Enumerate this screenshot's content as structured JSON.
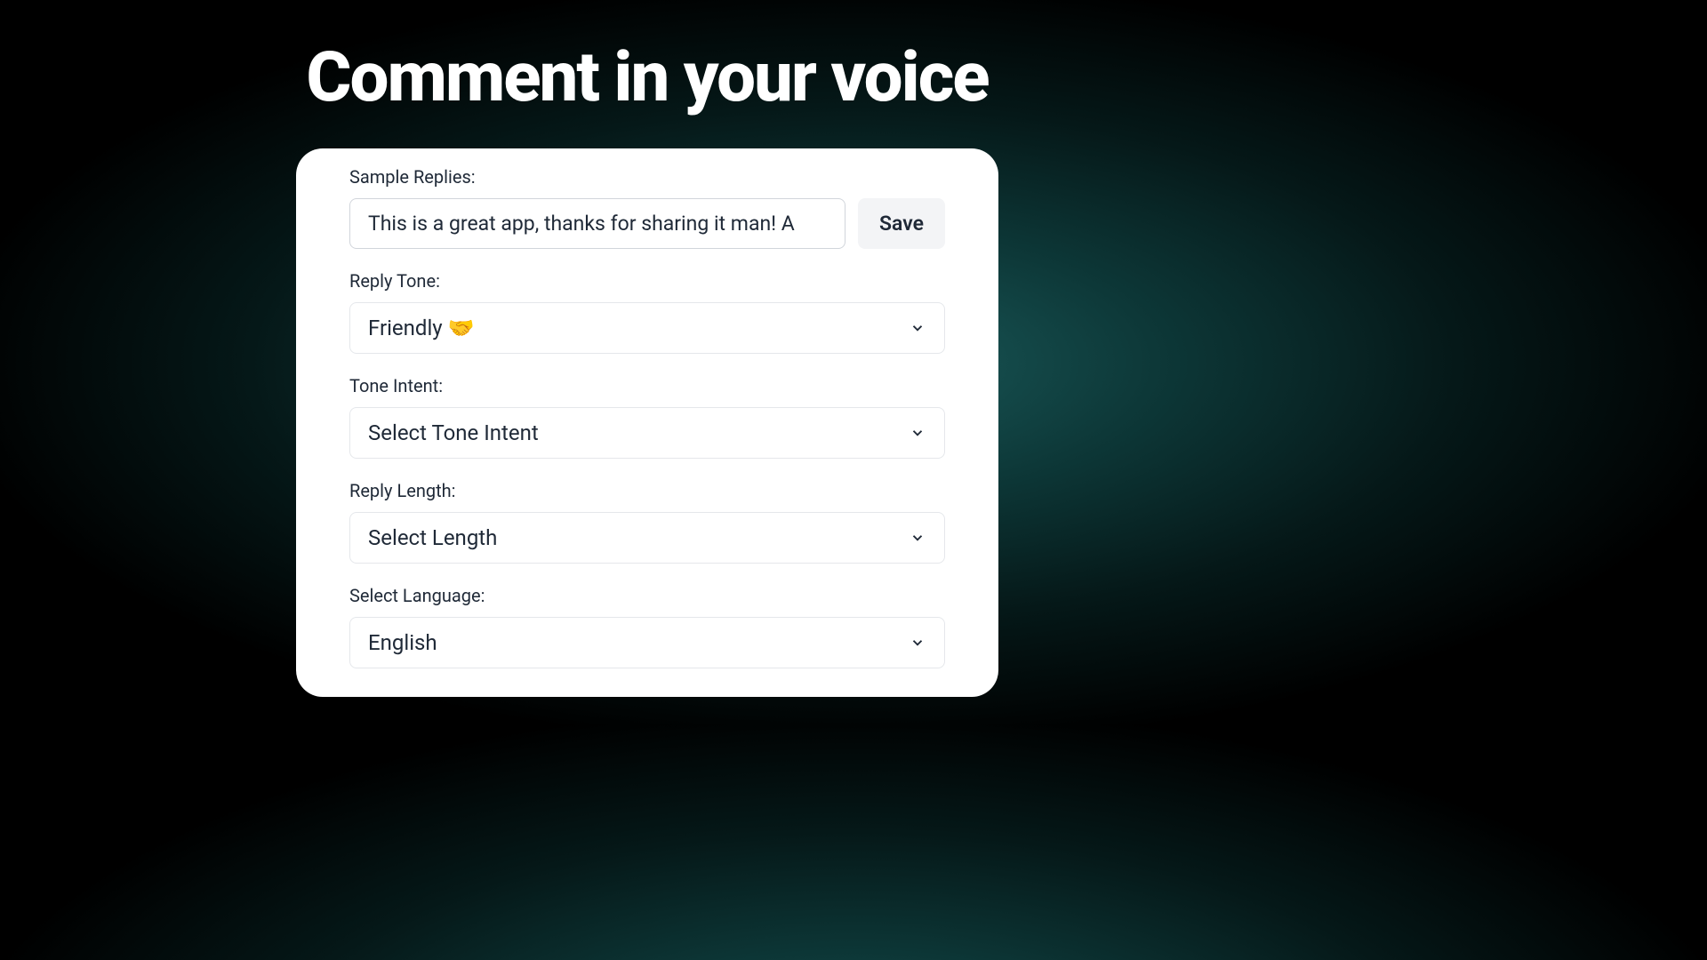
{
  "title": "Comment in your voice",
  "form": {
    "sample_replies": {
      "label": "Sample Replies:",
      "value": "This is a great app, thanks for sharing it man! A",
      "save_label": "Save"
    },
    "reply_tone": {
      "label": "Reply Tone:",
      "value": "Friendly 🤝"
    },
    "tone_intent": {
      "label": "Tone Intent:",
      "value": "Select Tone Intent"
    },
    "reply_length": {
      "label": "Reply Length:",
      "value": "Select Length"
    },
    "select_language": {
      "label": "Select Language:",
      "value": "English"
    }
  }
}
